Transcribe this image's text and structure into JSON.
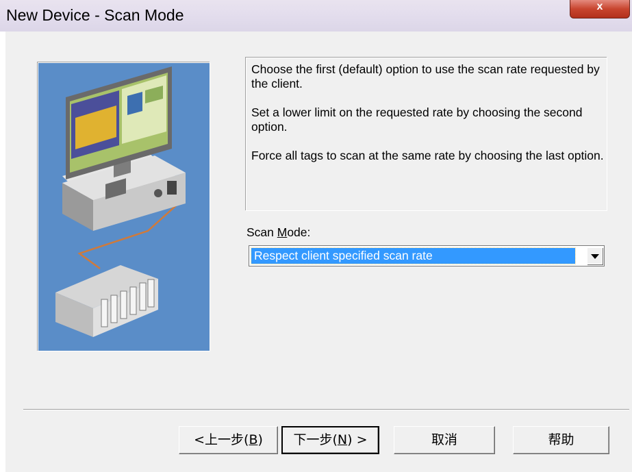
{
  "window": {
    "title": "New Device - Scan Mode",
    "close_label": "x"
  },
  "info": {
    "paragraphs": [
      "Choose the first (default) option to use the scan rate requested by the client.",
      "Set a lower limit on the requested rate by choosing the second option.",
      "Force all tags to scan at the same rate by choosing the last option."
    ]
  },
  "scan_mode": {
    "label_prefix": "Scan ",
    "label_accel": "M",
    "label_suffix": "ode:",
    "selected": "Respect client specified scan rate"
  },
  "buttons": {
    "back": {
      "prefix": "<上一步(",
      "accel": "B",
      "suffix": ")"
    },
    "next": {
      "prefix": "下一步(",
      "accel": "N",
      "suffix": ") >"
    },
    "cancel": "取消",
    "help": "帮助"
  },
  "colors": {
    "illustration_bg": "#5a8dc8",
    "selection": "#3399ff",
    "dialog_bg": "#f0f0f0"
  },
  "icons": {
    "illustration": "computer-plc-connection-illustration",
    "close": "close-icon",
    "dropdown": "chevron-down-icon"
  }
}
